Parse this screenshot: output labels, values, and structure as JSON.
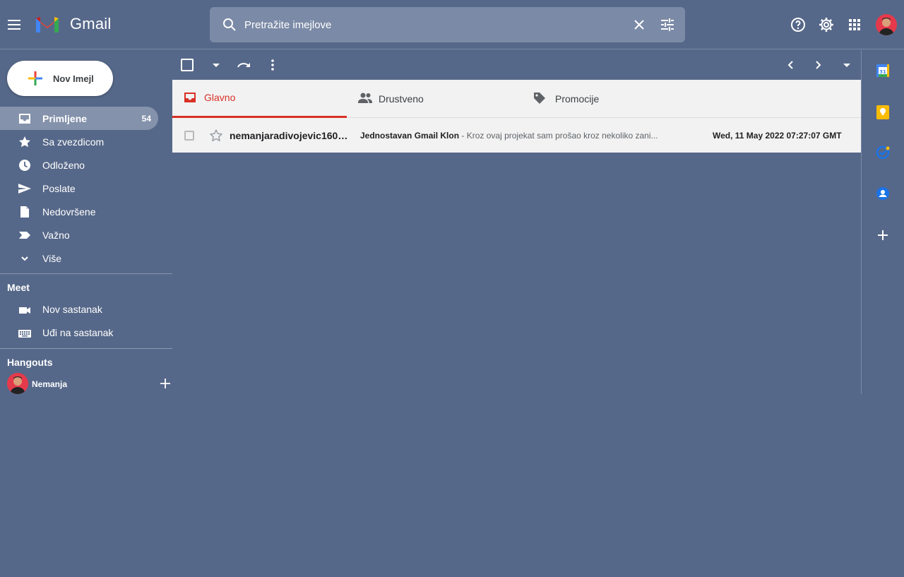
{
  "app": {
    "name": "Gmail"
  },
  "search": {
    "placeholder": "Pretražite imejlove"
  },
  "compose": {
    "label": "Nov Imejl"
  },
  "nav": {
    "items": [
      {
        "label": "Primljene",
        "count": "54"
      },
      {
        "label": "Sa zvezdicom"
      },
      {
        "label": "Odloženo"
      },
      {
        "label": "Poslate"
      },
      {
        "label": "Nedovršene"
      },
      {
        "label": "Važno"
      },
      {
        "label": "Više"
      }
    ]
  },
  "meet": {
    "title": "Meet",
    "items": [
      {
        "label": "Nov sastanak"
      },
      {
        "label": "Uđi na sastanak"
      }
    ]
  },
  "hangouts": {
    "title": "Hangouts",
    "user": "Nemanja"
  },
  "tabs": [
    {
      "label": "Glavno",
      "active": true
    },
    {
      "label": "Drustveno"
    },
    {
      "label": "Promocije"
    }
  ],
  "emails": [
    {
      "sender": "nemanjaradivojevic1603...",
      "subject": "Jednostavan Gmail Klon",
      "snippet": " - Kroz ovaj projekat sam prošao kroz nekoliko zani...",
      "date": "Wed, 11 May 2022 07:27:07 GMT"
    }
  ],
  "colors": {
    "background": "#566889",
    "accent": "#d93025",
    "active_nav": "#8492ab"
  },
  "icons": [
    "menu-icon",
    "gmail-logo",
    "search-icon",
    "close-icon",
    "tune-icon",
    "help-icon",
    "settings-icon",
    "apps-icon",
    "inbox-icon",
    "star-icon",
    "clock-icon",
    "send-icon",
    "file-icon",
    "label-important-icon",
    "chevron-down-icon",
    "video-icon",
    "keyboard-icon",
    "refresh-icon",
    "more-vert-icon",
    "chevron-left-icon",
    "chevron-right-icon",
    "people-icon",
    "tag-icon",
    "calendar-icon",
    "keep-icon",
    "tasks-icon",
    "contacts-icon",
    "plus-icon"
  ]
}
